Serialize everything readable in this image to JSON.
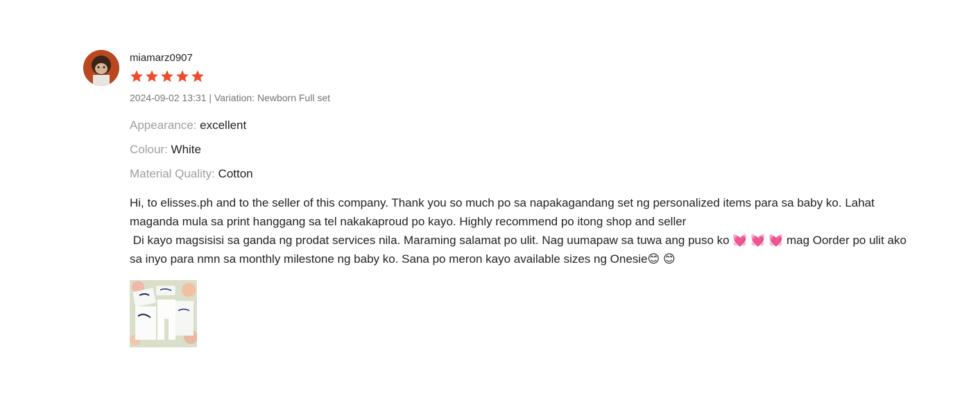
{
  "review": {
    "username": "miamarz0907",
    "rating": 5,
    "star_color": "#ee4d2d",
    "meta": "2024-09-02 13:31 | Variation: Newborn Full set",
    "attributes": [
      {
        "label": "Appearance: ",
        "value": "excellent"
      },
      {
        "label": "Colour: ",
        "value": "White"
      },
      {
        "label": "Material Quality: ",
        "value": "Cotton"
      }
    ],
    "body": "Hi, to elisses.ph and to the seller of this company. Thank you so much po sa napakagandang set ng personalized items para sa baby ko. Lahat maganda mula sa print hanggang sa tel nakakaproud po kayo. Highly recommend po itong shop and seller\n Di kayo magsisisi sa ganda ng prodat services nila. Maraming salamat po ulit. Nag uumapaw sa tuwa ang puso ko 💓 💓 💓 mag Oorder po ulit ako sa inyo para nmn sa monthly milestone ng baby ko. Sana po meron kayo available sizes ng Onesie😊 😊"
  }
}
